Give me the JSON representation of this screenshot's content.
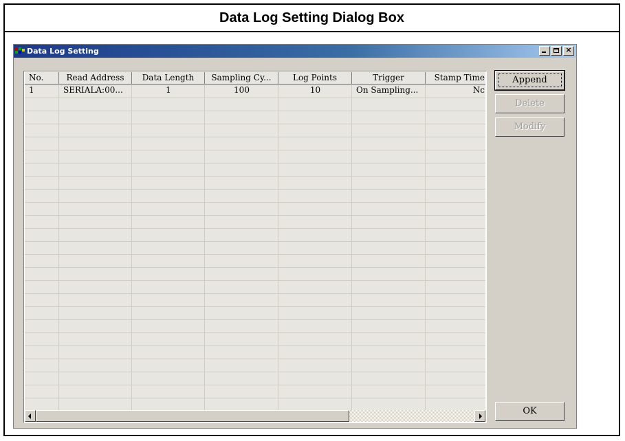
{
  "figure": {
    "caption": "Data Log Setting Dialog Box"
  },
  "window": {
    "title": "Data Log Setting",
    "controls": {
      "minimize": "minimize",
      "maximize": "maximize",
      "close": "×"
    }
  },
  "table": {
    "columns": [
      "No.",
      "Read Address",
      "Data Length",
      "Sampling Cy...",
      "Log Points",
      "Trigger",
      "Stamp Time"
    ],
    "rows": [
      [
        "1",
        "SERIALA:00...",
        "1",
        "100",
        "10",
        "On Sampling...",
        "Nc"
      ]
    ]
  },
  "buttons": {
    "append": "Append",
    "delete": "Delete",
    "modify": "Modify",
    "ok": "OK"
  },
  "icons": {
    "app": "data-log-app-icon",
    "scroll_left": "scroll-left-arrow-icon",
    "scroll_right": "scroll-right-arrow-icon"
  }
}
